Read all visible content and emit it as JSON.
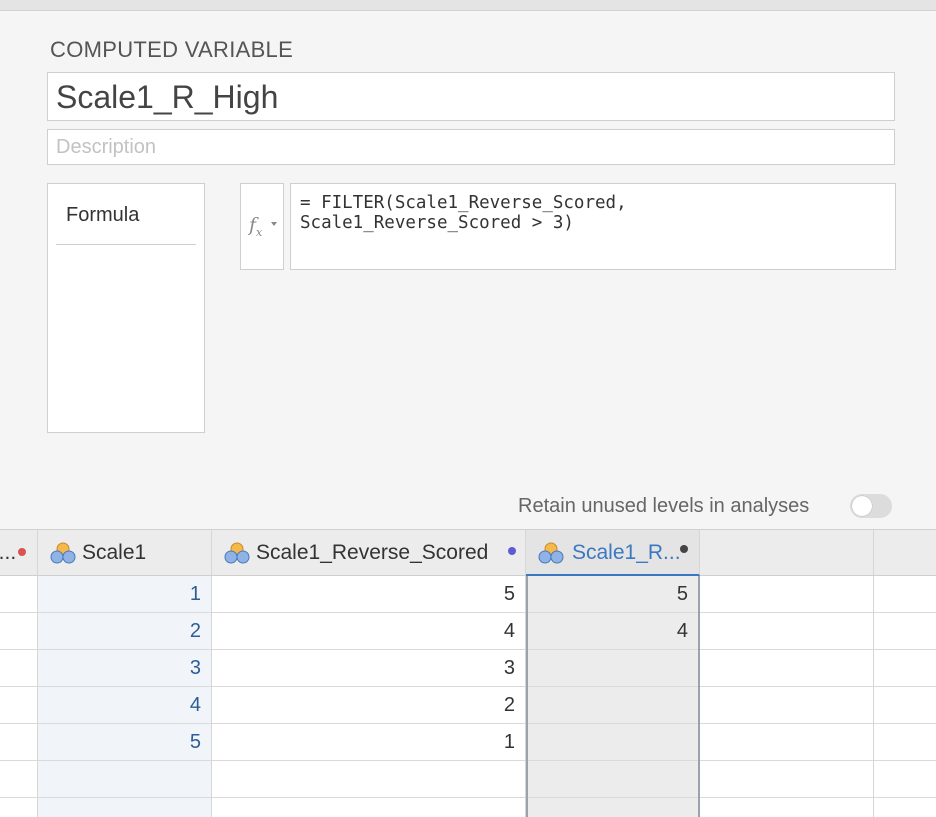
{
  "editor": {
    "heading": "COMPUTED VARIABLE",
    "variable_name": "Scale1_R_High",
    "description_placeholder": "Description",
    "side_tab": "Formula",
    "formula_line1": "= FILTER(Scale1_Reverse_Scored,",
    "formula_line2": "Scale1_Reverse_Scored > 3)",
    "retain_label": "Retain unused levels in analyses",
    "retain_enabled": false
  },
  "grid": {
    "columns": [
      {
        "label": "l...",
        "dot_color": "#d9534f"
      },
      {
        "label": "Scale1",
        "icon": "nominal-variable-icon"
      },
      {
        "label": "Scale1_Reverse_Scored",
        "icon": "nominal-variable-icon",
        "dot_color": "#5b5bd6"
      },
      {
        "label": "Scale1_R...",
        "icon": "nominal-variable-icon",
        "dot_color": "#444444",
        "selected": true
      }
    ],
    "scale1_values": [
      "1",
      "2",
      "3",
      "4",
      "5"
    ],
    "reverse_values": [
      "5",
      "4",
      "3",
      "2",
      "1"
    ],
    "r_high_values": [
      "5",
      "4"
    ]
  },
  "colors": {
    "accent": "#3b78c2",
    "scale1_text": "#2c5d96"
  }
}
